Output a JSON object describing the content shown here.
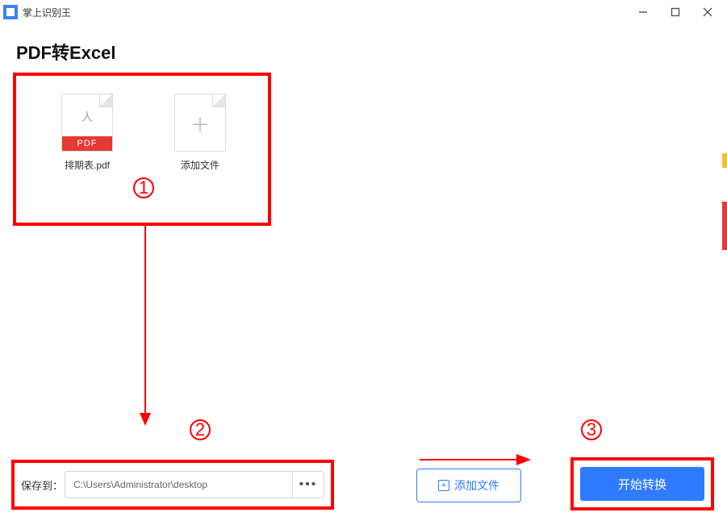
{
  "titlebar": {
    "app_name": "掌上识别王"
  },
  "heading": "PDF转Excel",
  "files": {
    "item1_name": "排期表.pdf",
    "item1_badge": "PDF",
    "add_label": "添加文件"
  },
  "annotations": {
    "one": "1",
    "two": "2",
    "three": "3"
  },
  "bottom": {
    "save_label": "保存到：",
    "path_value": "C:\\Users\\Administrator\\desktop",
    "browse_label": "•••",
    "add_file_label": "添加文件",
    "start_label": "开始转换"
  }
}
